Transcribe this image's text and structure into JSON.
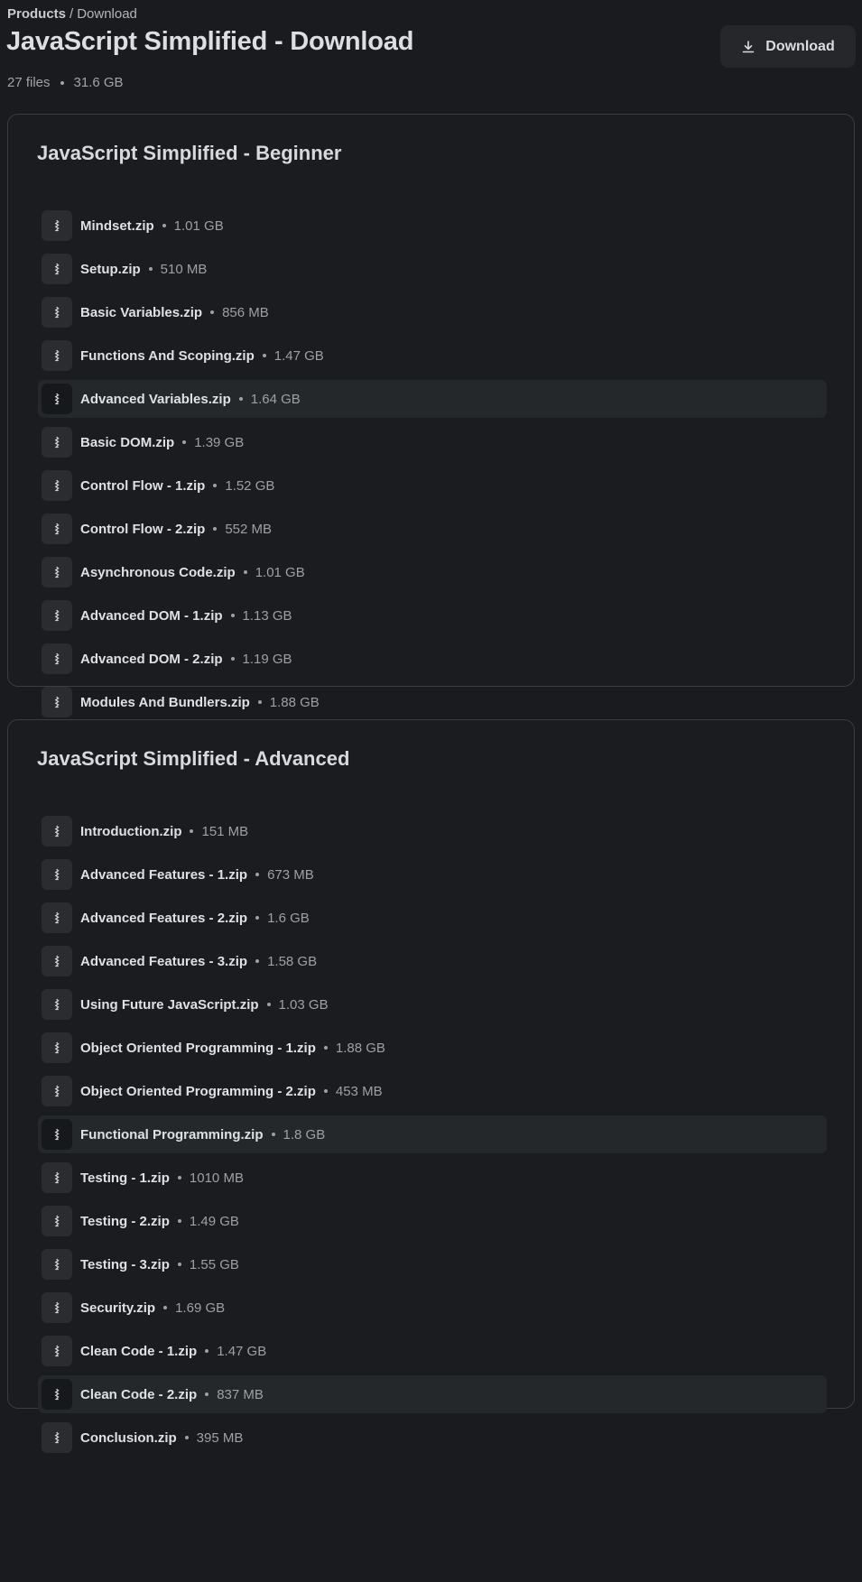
{
  "breadcrumb": {
    "root": "Products",
    "separator": "/",
    "current": "Download"
  },
  "header": {
    "title": "JavaScript Simplified - Download",
    "file_count": "27 files",
    "total_size": "31.6 GB",
    "download_label": "Download",
    "download_icon": "download-icon"
  },
  "sections": [
    {
      "title": "JavaScript Simplified - Beginner",
      "files": [
        {
          "name": "Mindset.zip",
          "size": "1.01 GB"
        },
        {
          "name": "Setup.zip",
          "size": "510 MB"
        },
        {
          "name": "Basic Variables.zip",
          "size": "856 MB"
        },
        {
          "name": "Functions And Scoping.zip",
          "size": "1.47 GB"
        },
        {
          "name": "Advanced Variables.zip",
          "size": "1.64 GB",
          "highlighted": true
        },
        {
          "name": "Basic DOM.zip",
          "size": "1.39 GB"
        },
        {
          "name": "Control Flow - 1.zip",
          "size": "1.52 GB"
        },
        {
          "name": "Control Flow - 2.zip",
          "size": "552 MB"
        },
        {
          "name": "Asynchronous Code.zip",
          "size": "1.01 GB"
        },
        {
          "name": "Advanced DOM - 1.zip",
          "size": "1.13 GB"
        },
        {
          "name": "Advanced DOM - 2.zip",
          "size": "1.19 GB"
        },
        {
          "name": "Modules And Bundlers.zip",
          "size": "1.88 GB"
        }
      ]
    },
    {
      "title": "JavaScript Simplified - Advanced",
      "files": [
        {
          "name": "Introduction.zip",
          "size": "151 MB"
        },
        {
          "name": "Advanced Features - 1.zip",
          "size": "673 MB"
        },
        {
          "name": "Advanced Features - 2.zip",
          "size": "1.6 GB"
        },
        {
          "name": "Advanced Features - 3.zip",
          "size": "1.58 GB"
        },
        {
          "name": "Using Future JavaScript.zip",
          "size": "1.03 GB"
        },
        {
          "name": "Object Oriented Programming - 1.zip",
          "size": "1.88 GB"
        },
        {
          "name": "Object Oriented Programming - 2.zip",
          "size": "453 MB"
        },
        {
          "name": "Functional Programming.zip",
          "size": "1.8 GB",
          "highlighted": true
        },
        {
          "name": "Testing - 1.zip",
          "size": "1010 MB"
        },
        {
          "name": "Testing - 2.zip",
          "size": "1.49 GB"
        },
        {
          "name": "Testing - 3.zip",
          "size": "1.55 GB"
        },
        {
          "name": "Security.zip",
          "size": "1.69 GB"
        },
        {
          "name": "Clean Code - 1.zip",
          "size": "1.47 GB"
        },
        {
          "name": "Clean Code - 2.zip",
          "size": "837 MB",
          "highlighted": true
        },
        {
          "name": "Conclusion.zip",
          "size": "395 MB"
        }
      ]
    }
  ],
  "icons": {
    "file": "zip-file-icon"
  },
  "colors": {
    "background": "#1a1b1e",
    "row_highlight": "#25282b",
    "text_primary": "#dfe0e3",
    "text_muted": "#9da0a5"
  }
}
